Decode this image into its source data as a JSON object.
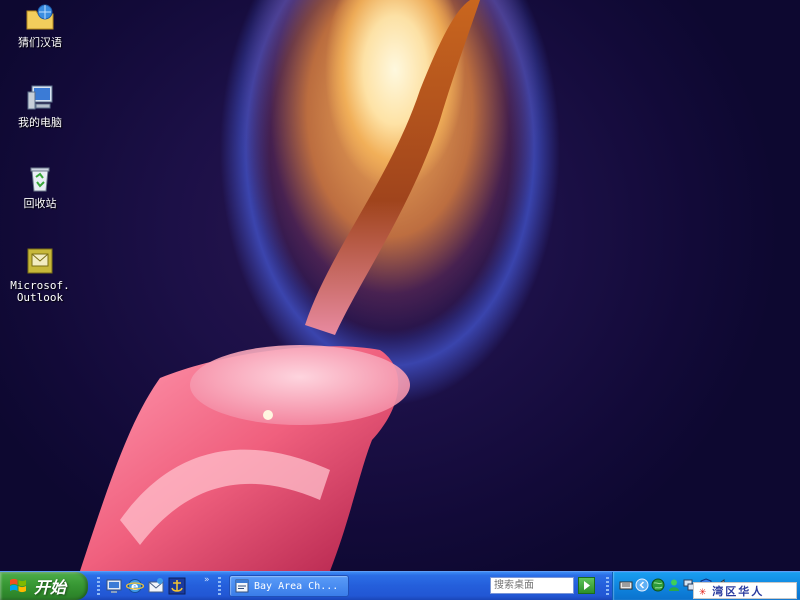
{
  "desktop": {
    "icons": [
      {
        "name": "desktop-icon-browser",
        "label": "猜们汉语",
        "icon": "folder-globe-icon"
      },
      {
        "name": "desktop-icon-my-computer",
        "label": "我的电脑",
        "icon": "computer-icon"
      },
      {
        "name": "desktop-icon-recycle-bin",
        "label": "回收站",
        "icon": "recycle-bin-icon"
      },
      {
        "name": "desktop-icon-outlook",
        "label": "Microsof.\nOutlook",
        "icon": "outlook-icon"
      }
    ]
  },
  "taskbar": {
    "start_label": "开始",
    "chevron": "»",
    "task_button_label": "Bay Area Ch...",
    "search_placeholder": "搜索桌面",
    "brand_star": "✳",
    "brand_text": "湾区华人"
  },
  "colors": {
    "taskbar_blue": "#245edb",
    "start_green": "#3a9a36",
    "tray_blue": "#0f86e0",
    "brand_red": "#e0201a",
    "brand_blue": "#2a3a9e"
  }
}
